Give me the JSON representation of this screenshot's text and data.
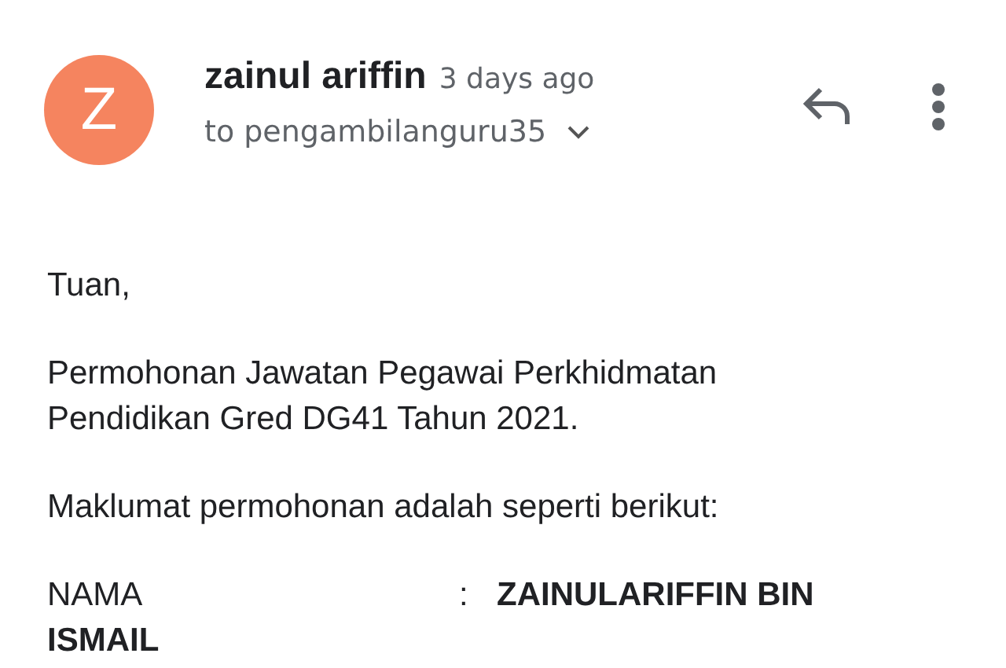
{
  "sender": {
    "initial": "Z",
    "name": "zainul ariffin",
    "time": "3 days ago",
    "recipient": "to pengambilanguru35"
  },
  "body": {
    "greeting": "Tuan,",
    "subject_lines": [
      "Permohonan Jawatan Pegawai Perkhidmatan",
      "Pendidikan Gred DG41 Tahun 2021."
    ],
    "intro": "Maklumat permohonan adalah seperti berikut:",
    "fields": [
      {
        "label": "NAMA",
        "separator": ":",
        "value": "ZAINULARIFFIN BIN ISMAIL"
      }
    ]
  }
}
